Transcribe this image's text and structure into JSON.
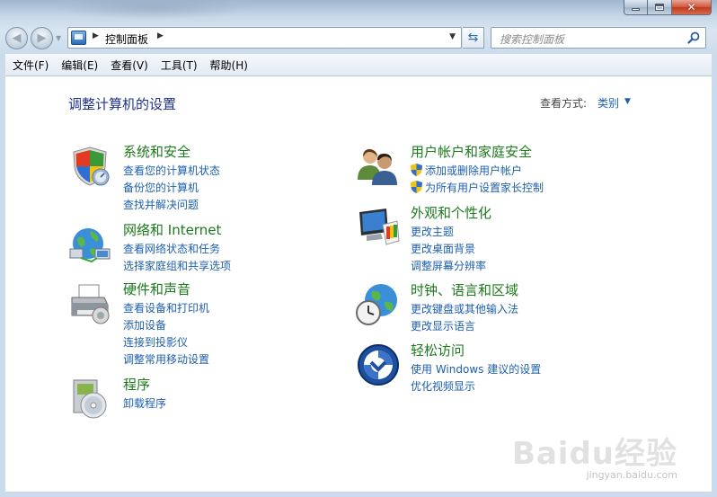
{
  "window": {
    "controls": [
      "minimize",
      "maximize",
      "close"
    ]
  },
  "nav": {
    "address_path": "控制面板",
    "search_placeholder": "搜索控制面板"
  },
  "menu": {
    "items": [
      {
        "label": "文件(F)"
      },
      {
        "label": "编辑(E)"
      },
      {
        "label": "查看(V)"
      },
      {
        "label": "工具(T)"
      },
      {
        "label": "帮助(H)"
      }
    ]
  },
  "content": {
    "title": "调整计算机的设置",
    "view_by_label": "查看方式:",
    "view_by_value": "类别"
  },
  "categories": {
    "system_security": {
      "title": "系统和安全",
      "icon": "shield-icon",
      "links": [
        "查看您的计算机状态",
        "备份您的计算机",
        "查找并解决问题"
      ]
    },
    "network": {
      "title": "网络和 Internet",
      "icon": "globe-network-icon",
      "links": [
        "查看网络状态和任务",
        "选择家庭组和共享选项"
      ]
    },
    "hardware": {
      "title": "硬件和声音",
      "icon": "printer-icon",
      "links": [
        "查看设备和打印机",
        "添加设备",
        "连接到投影仪",
        "调整常用移动设置"
      ]
    },
    "programs": {
      "title": "程序",
      "icon": "programs-disc-icon",
      "links": [
        "卸载程序"
      ]
    },
    "user_accounts": {
      "title": "用户帐户和家庭安全",
      "icon": "users-icon",
      "links": [
        "添加或删除用户帐户",
        "为所有用户设置家长控制"
      ]
    },
    "appearance": {
      "title": "外观和个性化",
      "icon": "monitor-palette-icon",
      "links": [
        "更改主题",
        "更改桌面背景",
        "调整屏幕分辨率"
      ]
    },
    "clock_region": {
      "title": "时钟、语言和区域",
      "icon": "clock-globe-icon",
      "links": [
        "更改键盘或其他输入法",
        "更改显示语言"
      ]
    },
    "ease_access": {
      "title": "轻松访问",
      "icon": "ease-of-access-icon",
      "links": [
        "使用 Windows 建议的设置",
        "优化视频显示"
      ]
    }
  },
  "watermark": {
    "logo": "Baidu经验",
    "url": "jingyan.baidu.com"
  }
}
